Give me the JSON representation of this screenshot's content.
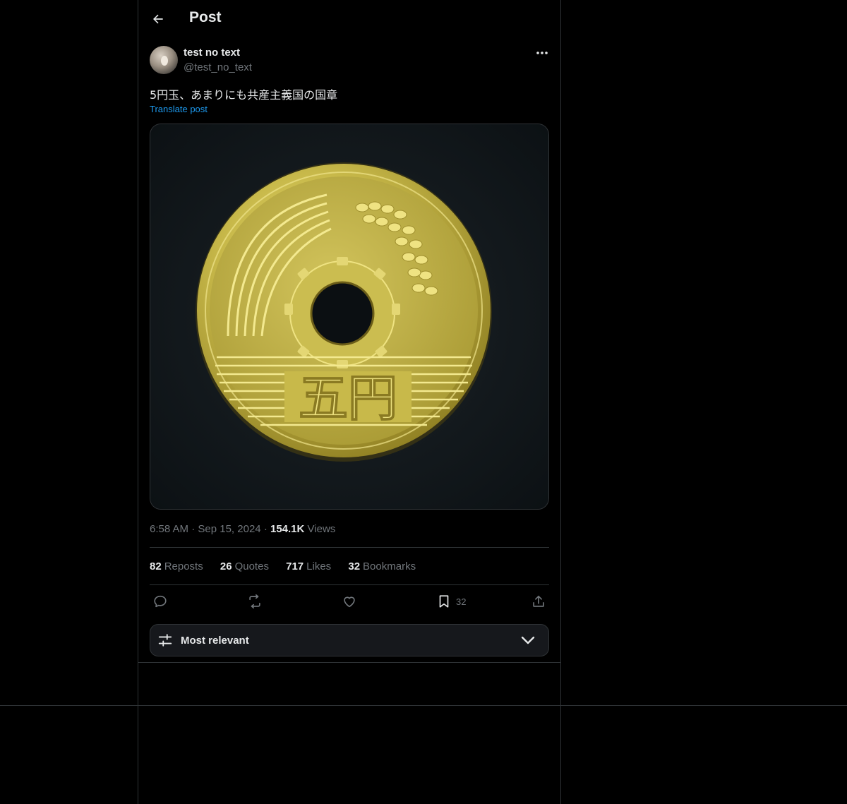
{
  "header": {
    "title": "Post",
    "back_icon": "arrow-left-icon"
  },
  "author": {
    "display_name": "test no text",
    "handle": "@test_no_text"
  },
  "post": {
    "text": "5円玉、あまりにも共産主義国の国章",
    "translate_label": "Translate post",
    "time": "6:58 AM",
    "date": "Sep 15, 2024",
    "views_count": "154.1K",
    "views_label": "Views"
  },
  "media": {
    "coin_text": "五円"
  },
  "stats": {
    "reposts_count": "82",
    "reposts_label": "Reposts",
    "quotes_count": "26",
    "quotes_label": "Quotes",
    "likes_count": "717",
    "likes_label": "Likes",
    "bookmarks_count": "32",
    "bookmarks_label": "Bookmarks"
  },
  "actions": {
    "reply_icon": "reply-icon",
    "repost_icon": "repost-icon",
    "like_icon": "heart-icon",
    "bookmark_icon": "bookmark-icon",
    "bookmark_count": "32",
    "share_icon": "share-icon"
  },
  "sort": {
    "label": "Most relevant"
  },
  "colors": {
    "background": "#000000",
    "text": "#e7e9ea",
    "muted": "#71767b",
    "link": "#1d9bf0",
    "border": "#2f3336"
  }
}
